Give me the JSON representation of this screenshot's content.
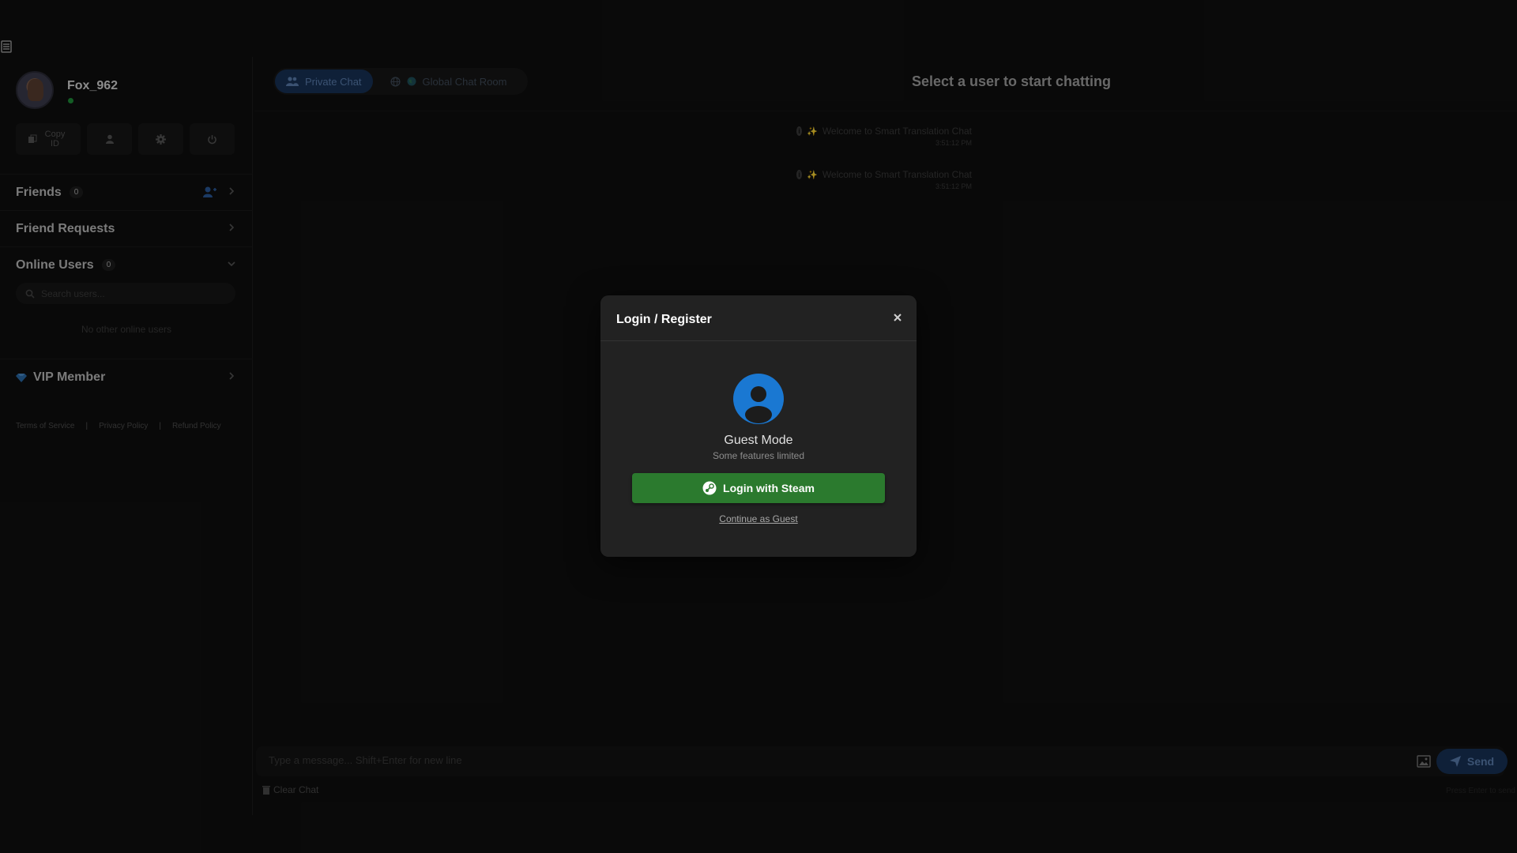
{
  "sidebar": {
    "username": "Fox_962",
    "tools": {
      "copy_id_label": "Copy ID"
    },
    "friends": {
      "title": "Friends",
      "count": "0"
    },
    "friend_requests": {
      "title": "Friend Requests"
    },
    "online_users": {
      "title": "Online Users",
      "count": "0",
      "search_placeholder": "Search users...",
      "empty_text": "No other online users"
    },
    "vip": {
      "title": "VIP Member"
    },
    "footer": {
      "terms": "Terms of Service",
      "sep": "|",
      "privacy": "Privacy Policy",
      "refund": "Refund Policy"
    }
  },
  "main": {
    "tabs": [
      {
        "label": "Private Chat"
      },
      {
        "label": "Global Chat Room"
      }
    ],
    "title": "Select a user to start chatting",
    "messages": [
      {
        "sparkle": "✨",
        "text": "Welcome to Smart Translation Chat",
        "time": "3:51:12 PM"
      },
      {
        "sparkle": "✨",
        "text": "Welcome to Smart Translation Chat",
        "time": "3:51:12 PM"
      }
    ],
    "input_placeholder": "Type a message... Shift+Enter for new line",
    "send_label": "Send",
    "clear_label": "Clear Chat",
    "enter_hint": "Press Enter to send"
  },
  "modal": {
    "title": "Login / Register",
    "guest_title": "Guest Mode",
    "guest_subtitle": "Some features limited",
    "steam_label": "Login with Steam",
    "guest_link": "Continue as Guest"
  },
  "colors": {
    "accent_blue": "#1a78d2",
    "steam_green": "#2b7a2e",
    "online_green": "#1f8f3a"
  },
  "icons": [
    "menu-icon",
    "copy-icon",
    "user-icon",
    "gear-icon",
    "power-icon",
    "add-user-icon",
    "chevron-right-icon",
    "chevron-down-icon",
    "search-icon",
    "diamond-icon",
    "users-icon",
    "globe-icon",
    "info-icon",
    "image-icon",
    "send-icon",
    "trash-icon",
    "close-icon",
    "steam-icon"
  ]
}
